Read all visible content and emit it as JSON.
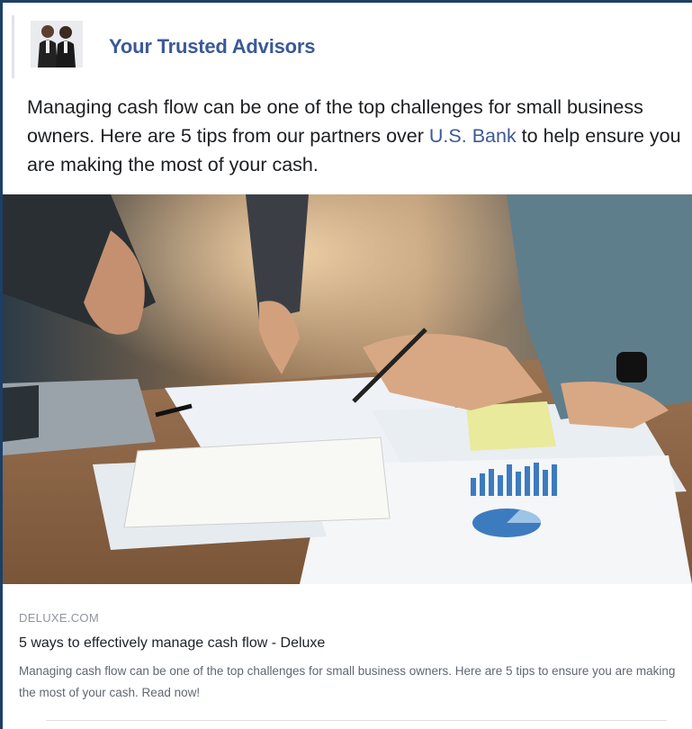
{
  "post": {
    "page_name": "Your Trusted Advisors",
    "text_before_link": "Managing cash flow can be one of the top challenges for small business owners. Here are 5 tips from our partners over ",
    "text_link": "U.S. Bank",
    "text_after_link": " to help ensure you are making the most of your cash."
  },
  "link_preview": {
    "domain": "DELUXE.COM",
    "title": "5 ways to effectively manage cash flow - Deluxe",
    "description": "Managing cash flow can be one of the top challenges for small business owners. Here are 5 tips to ensure you are making the most of your cash. Read now!"
  },
  "colors": {
    "page_background": "#1d3f66",
    "page_name": "#3b5998",
    "link": "#3b5998"
  }
}
